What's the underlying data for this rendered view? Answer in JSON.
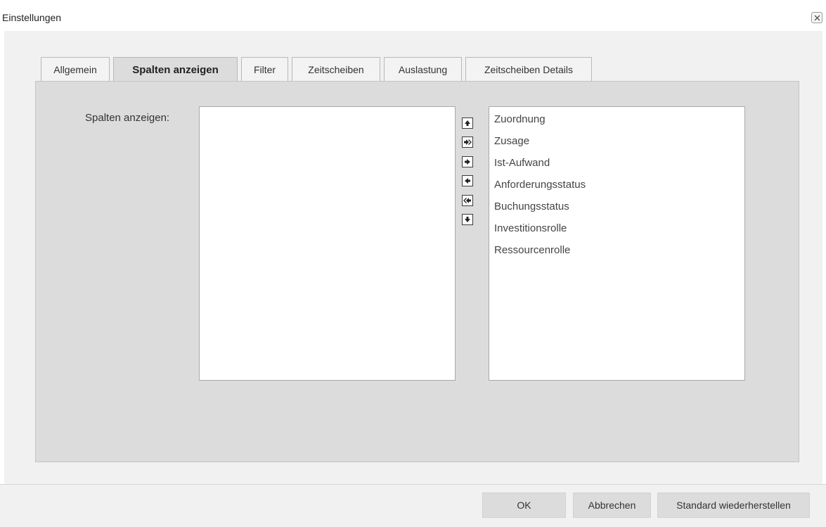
{
  "window": {
    "title": "Einstellungen",
    "close_icon": "close-icon"
  },
  "tabs": [
    {
      "label": "Allgemein",
      "active": false
    },
    {
      "label": "Spalten anzeigen",
      "active": true
    },
    {
      "label": "Filter",
      "active": false
    },
    {
      "label": "Zeitscheiben",
      "active": false
    },
    {
      "label": "Auslastung",
      "active": false
    },
    {
      "label": "Zeitscheiben Details",
      "active": false
    }
  ],
  "columns_panel": {
    "label": "Spalten anzeigen:",
    "available_items": [],
    "shown_items": [
      "Zuordnung",
      "Zusage",
      "Ist-Aufwand",
      "Anforderungsstatus",
      "Buchungsstatus",
      "Investitionsrolle",
      "Ressourcenrolle"
    ],
    "move_buttons": [
      {
        "icon": "arrow-up-icon",
        "action": "move-up"
      },
      {
        "icon": "double-arrow-right-icon",
        "action": "add-all"
      },
      {
        "icon": "arrow-right-icon",
        "action": "add"
      },
      {
        "icon": "arrow-left-icon",
        "action": "remove"
      },
      {
        "icon": "double-arrow-left-icon",
        "action": "remove-all"
      },
      {
        "icon": "arrow-down-icon",
        "action": "move-down"
      }
    ]
  },
  "footer": {
    "ok_label": "OK",
    "cancel_label": "Abbrechen",
    "restore_label": "Standard wiederherstellen"
  },
  "colors": {
    "panel_background": "#dcdcdc",
    "dialog_background": "#f1f1f1",
    "list_background": "#ffffff"
  }
}
